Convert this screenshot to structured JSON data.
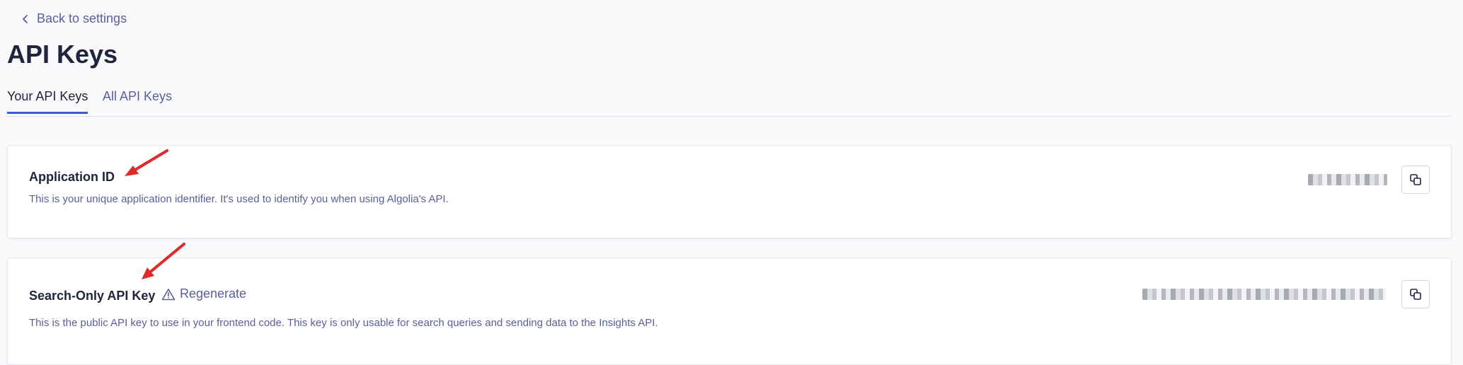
{
  "nav": {
    "back_label": "Back to settings"
  },
  "page": {
    "title": "API Keys"
  },
  "tabs": [
    {
      "label": "Your API Keys",
      "active": true
    },
    {
      "label": "All API Keys",
      "active": false
    }
  ],
  "cards": [
    {
      "title": "Application ID",
      "description": "This is your unique application identifier. It's used to identify you when using Algolia's API."
    },
    {
      "title": "Search-Only API Key",
      "regenerate_label": "Regenerate",
      "description": "This is the public API key to use in your frontend code. This key is only usable for search queries and sending data to the Insights API."
    }
  ],
  "colors": {
    "accent": "#3a5ad8",
    "annotation_arrow": "#e02a2a",
    "text_primary": "#21243d",
    "text_secondary": "#5a5e9a"
  },
  "icons": {
    "back": "chevron-left-icon",
    "copy": "copy-icon",
    "warning": "warning-triangle-icon",
    "annotation": "red-arrow-icon"
  }
}
